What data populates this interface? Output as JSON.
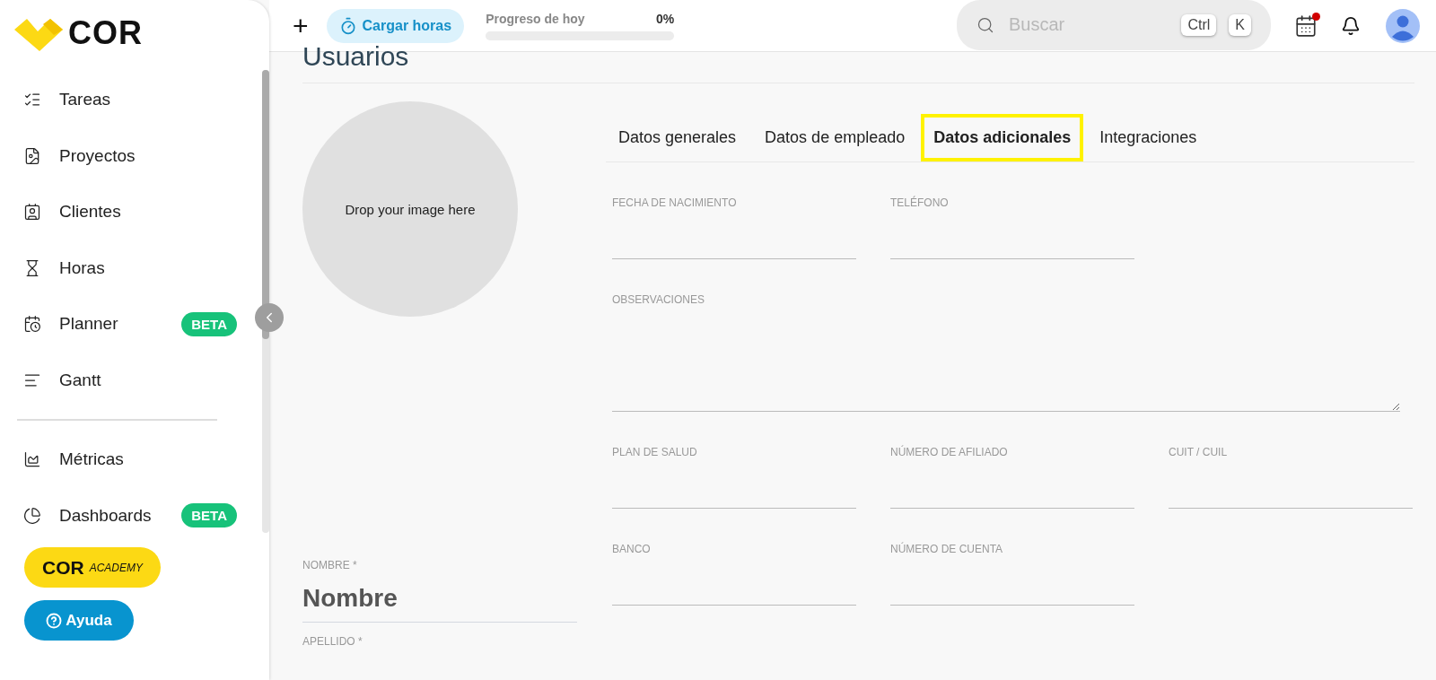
{
  "sidebar": {
    "logo": "COR",
    "sections": [
      [
        {
          "label": "Tareas"
        },
        {
          "label": "Proyectos"
        },
        {
          "label": "Clientes"
        },
        {
          "label": "Horas"
        },
        {
          "label": "Planner",
          "badge": "BETA"
        },
        {
          "label": "Gantt"
        }
      ],
      [
        {
          "label": "Métricas"
        },
        {
          "label": "Dashboards",
          "badge": "BETA"
        }
      ]
    ],
    "academy": {
      "brand": "COR",
      "tagline": "ACADEMY"
    },
    "help": "Ayuda"
  },
  "header": {
    "add": "+",
    "load_hours": "Cargar horas",
    "progress": {
      "label": "Progreso de hoy",
      "value": "0%",
      "level": 0
    },
    "search": {
      "placeholder": "Buscar",
      "keys": [
        "Ctrl",
        "K"
      ]
    },
    "calendar_alert": true
  },
  "page": {
    "title": "Usuarios",
    "dropzone": "Drop your image here",
    "tabs": [
      {
        "label": "Datos generales",
        "selected": false
      },
      {
        "label": "Datos de empleado",
        "selected": false
      },
      {
        "label": "Datos adicionales",
        "selected": true
      },
      {
        "label": "Integraciones",
        "selected": false
      }
    ],
    "field_rows": [
      [
        {
          "label": "FECHA DE NACIMIENTO",
          "kind": "line"
        },
        {
          "label": "TELÉFONO",
          "kind": "line"
        }
      ],
      [
        {
          "label": "OBSERVACIONES",
          "kind": "textarea"
        }
      ],
      [
        {
          "label": "PLAN DE SALUD",
          "kind": "line"
        },
        {
          "label": "NÚMERO DE AFILIADO",
          "kind": "line"
        },
        {
          "label": "CUIT / CUIL",
          "kind": "line"
        }
      ],
      [
        {
          "label": "BANCO",
          "kind": "line"
        },
        {
          "label": "NÚMERO DE CUENTA",
          "kind": "line"
        }
      ]
    ],
    "name_fields": [
      {
        "label": "NOMBRE *",
        "value": "Nombre"
      },
      {
        "label": "APELLIDO *"
      }
    ]
  }
}
